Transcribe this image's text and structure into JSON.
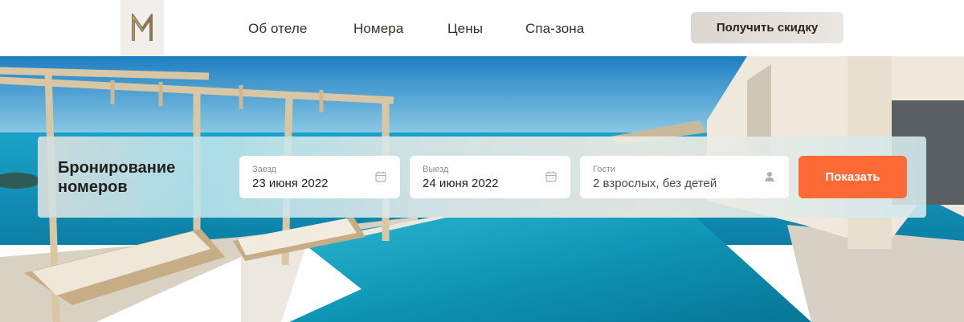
{
  "header": {
    "logo_letter": "M",
    "nav": [
      {
        "label": "Об отеле"
      },
      {
        "label": "Номера"
      },
      {
        "label": "Цены"
      },
      {
        "label": "Спа-зона"
      }
    ],
    "cta_label": "Получить скидку"
  },
  "booking": {
    "title": "Бронирование номеров",
    "checkin": {
      "label": "Заезд",
      "value": "23 июня 2022",
      "icon": "calendar-icon"
    },
    "checkout": {
      "label": "Выезд",
      "value": "24 июня 2022",
      "icon": "calendar-icon"
    },
    "guests": {
      "label": "Гости",
      "value": "2 взрослых, без детей",
      "icon": "person-icon"
    },
    "submit_label": "Показать"
  },
  "colors": {
    "accent": "#fd6a35",
    "cta_bg": "#e3ded8",
    "text_dark": "#3b2f25"
  }
}
